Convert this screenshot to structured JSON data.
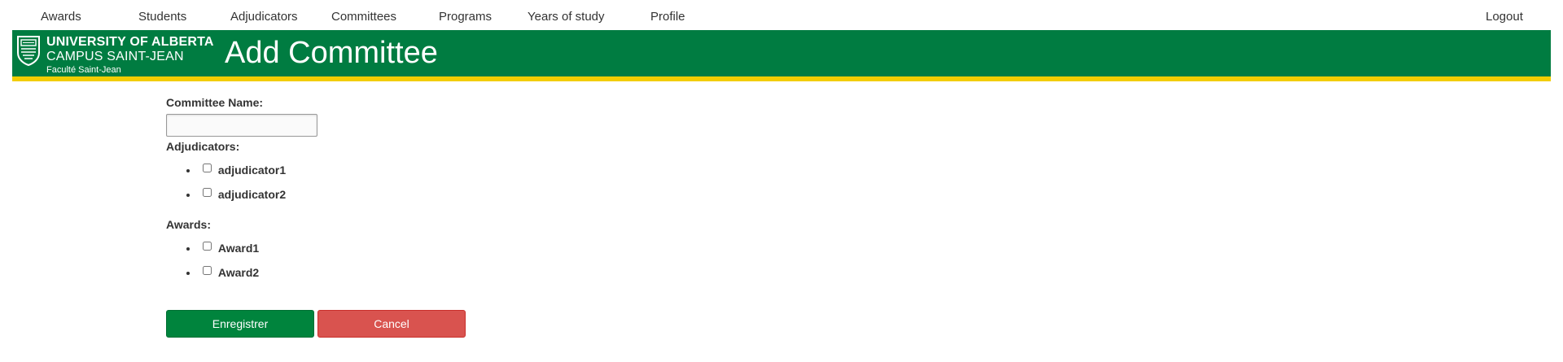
{
  "nav": {
    "items": [
      {
        "label": "Awards"
      },
      {
        "label": "Students"
      },
      {
        "label": "Adjudicators"
      },
      {
        "label": "Committees"
      },
      {
        "label": "Programs"
      },
      {
        "label": "Years of study"
      },
      {
        "label": "Profile"
      }
    ],
    "logout": "Logout"
  },
  "header": {
    "logo_line1": "UNIVERSITY OF ALBERTA",
    "logo_line2": "CAMPUS SAINT-JEAN",
    "logo_line3": "Faculté Saint-Jean",
    "title": "Add Committee",
    "bg_color": "#007c41",
    "stripe_color": "#f2cd00"
  },
  "form": {
    "name_label": "Committee Name:",
    "name_value": "",
    "adjudicators_label": "Adjudicators:",
    "adjudicators": [
      {
        "label": "adjudicator1",
        "checked": false
      },
      {
        "label": "adjudicator2",
        "checked": false
      }
    ],
    "awards_label": "Awards:",
    "awards": [
      {
        "label": "Award1",
        "checked": false
      },
      {
        "label": "Award2",
        "checked": false
      }
    ],
    "save_label": "Enregistrer",
    "cancel_label": "Cancel",
    "save_color": "#00843d",
    "cancel_color": "#d9534f"
  }
}
